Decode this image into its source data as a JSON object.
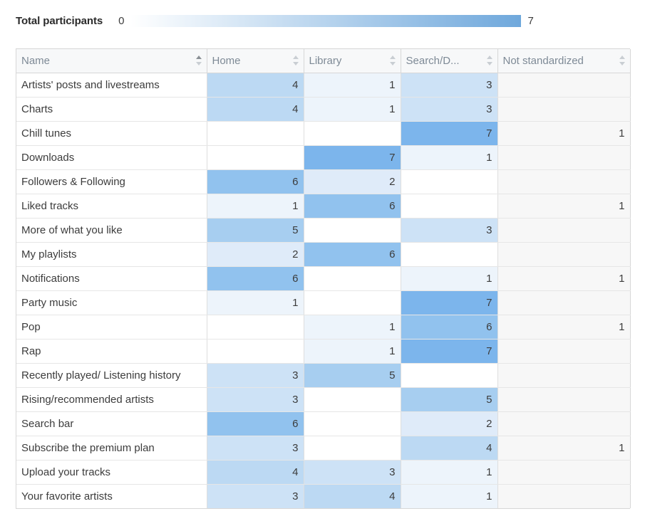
{
  "legend": {
    "title": "Total participants",
    "min": "0",
    "max": "7",
    "gradient_start": "#ffffff",
    "gradient_end": "#6fa8dc"
  },
  "table": {
    "columns": [
      {
        "label": "Name",
        "sorted": "asc"
      },
      {
        "label": "Home",
        "sorted": "none"
      },
      {
        "label": "Library",
        "sorted": "none"
      },
      {
        "label": "Search/D...",
        "sorted": "none"
      },
      {
        "label": "Not standardized",
        "sorted": "none"
      }
    ],
    "rows": [
      {
        "name": "Artists' posts and livestreams",
        "home": "4",
        "library": "1",
        "search": "3",
        "not_standardized": ""
      },
      {
        "name": "Charts",
        "home": "4",
        "library": "1",
        "search": "3",
        "not_standardized": ""
      },
      {
        "name": "Chill tunes",
        "home": "",
        "library": "",
        "search": "7",
        "not_standardized": "1"
      },
      {
        "name": "Downloads",
        "home": "",
        "library": "7",
        "search": "1",
        "not_standardized": ""
      },
      {
        "name": "Followers & Following",
        "home": "6",
        "library": "2",
        "search": "",
        "not_standardized": ""
      },
      {
        "name": "Liked tracks",
        "home": "1",
        "library": "6",
        "search": "",
        "not_standardized": "1"
      },
      {
        "name": "More of what you like",
        "home": "5",
        "library": "",
        "search": "3",
        "not_standardized": ""
      },
      {
        "name": "My playlists",
        "home": "2",
        "library": "6",
        "search": "",
        "not_standardized": ""
      },
      {
        "name": "Notifications",
        "home": "6",
        "library": "",
        "search": "1",
        "not_standardized": "1"
      },
      {
        "name": "Party music",
        "home": "1",
        "library": "",
        "search": "7",
        "not_standardized": ""
      },
      {
        "name": "Pop",
        "home": "",
        "library": "1",
        "search": "6",
        "not_standardized": "1"
      },
      {
        "name": "Rap",
        "home": "",
        "library": "1",
        "search": "7",
        "not_standardized": ""
      },
      {
        "name": "Recently played/ Listening history",
        "home": "3",
        "library": "5",
        "search": "",
        "not_standardized": ""
      },
      {
        "name": "Rising/recommended artists",
        "home": "3",
        "library": "",
        "search": "5",
        "not_standardized": ""
      },
      {
        "name": "Search bar",
        "home": "6",
        "library": "",
        "search": "2",
        "not_standardized": ""
      },
      {
        "name": "Subscribe the premium plan",
        "home": "3",
        "library": "",
        "search": "4",
        "not_standardized": "1"
      },
      {
        "name": "Upload your tracks",
        "home": "4",
        "library": "3",
        "search": "1",
        "not_standardized": ""
      },
      {
        "name": "Your favorite artists",
        "home": "3",
        "library": "4",
        "search": "1",
        "not_standardized": ""
      }
    ]
  },
  "chart_data": {
    "type": "heatmap",
    "title": "Total participants",
    "xlabel": "",
    "ylabel": "",
    "colorbar": {
      "min": 0,
      "max": 7,
      "start_color": "#ffffff",
      "end_color": "#6fa8dc"
    },
    "value_colors": {
      "0": "#ffffff",
      "1": "#edf4fb",
      "2": "#dfebf9",
      "3": "#cde2f6",
      "4": "#bcd9f3",
      "5": "#a7cef0",
      "6": "#91c2ee",
      "7": "#7cb5ec"
    },
    "heat_columns": [
      "Home",
      "Library",
      "Search/D..."
    ],
    "categories": [
      "Artists' posts and livestreams",
      "Charts",
      "Chill tunes",
      "Downloads",
      "Followers & Following",
      "Liked tracks",
      "More of what you like",
      "My playlists",
      "Notifications",
      "Party music",
      "Pop",
      "Rap",
      "Recently played/ Listening history",
      "Rising/recommended artists",
      "Search bar",
      "Subscribe the premium plan",
      "Upload your tracks",
      "Your favorite artists"
    ],
    "series": [
      {
        "name": "Home",
        "values": [
          4,
          4,
          null,
          null,
          6,
          1,
          5,
          2,
          6,
          1,
          null,
          null,
          3,
          3,
          6,
          3,
          4,
          3
        ]
      },
      {
        "name": "Library",
        "values": [
          1,
          1,
          null,
          7,
          2,
          6,
          null,
          6,
          null,
          null,
          1,
          1,
          5,
          null,
          null,
          null,
          3,
          4
        ]
      },
      {
        "name": "Search/D...",
        "values": [
          3,
          3,
          7,
          1,
          null,
          null,
          3,
          null,
          1,
          7,
          6,
          7,
          null,
          5,
          2,
          4,
          1,
          1
        ]
      },
      {
        "name": "Not standardized",
        "values": [
          null,
          null,
          1,
          null,
          null,
          1,
          null,
          null,
          1,
          null,
          1,
          null,
          null,
          null,
          null,
          1,
          null,
          null
        ]
      }
    ]
  }
}
